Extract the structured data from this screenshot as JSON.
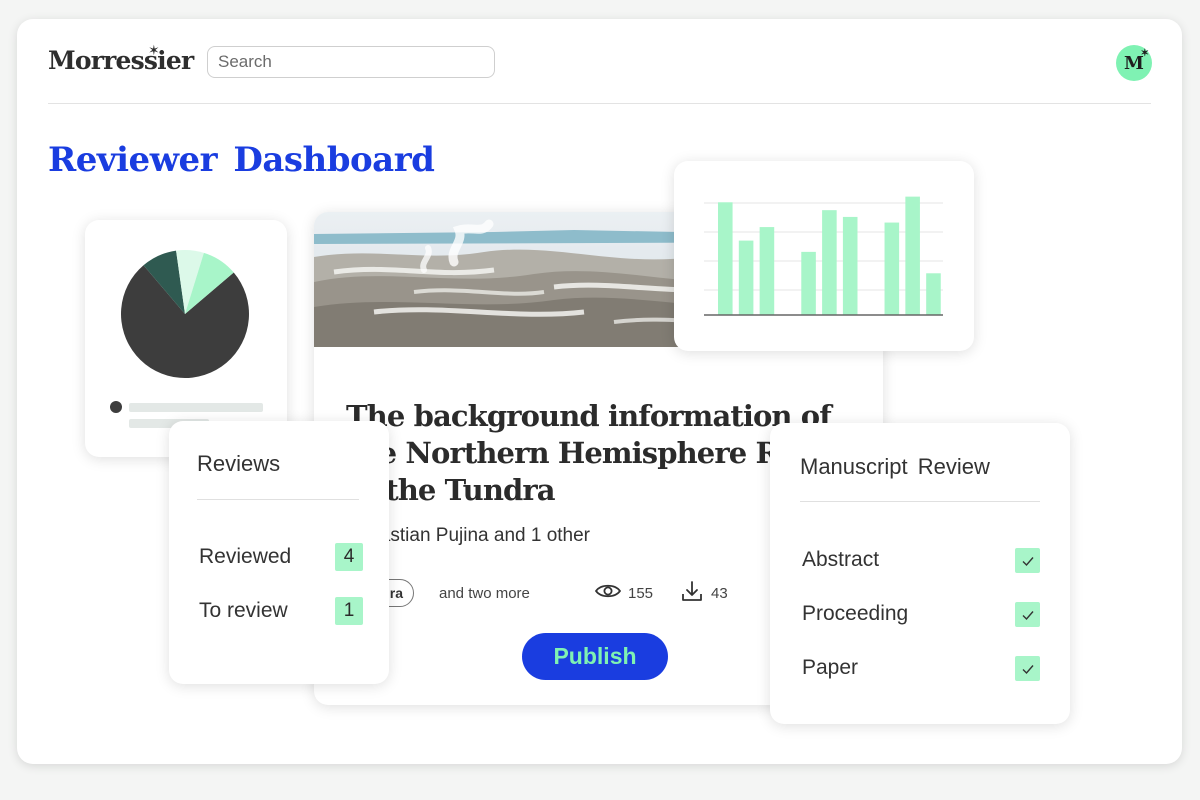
{
  "header": {
    "brand": "Morressier",
    "search_placeholder": "Search",
    "avatar_letter": "M"
  },
  "page_title": "Reviewer Dashboard",
  "article": {
    "title_lines": [
      "The background information of",
      "the Northern Hemisphere Region",
      "of the Tundra"
    ],
    "authors": "Sebastian Pujina and 1 other",
    "tag": "Tundra",
    "more_tags": "and two more",
    "views": "155",
    "downloads": "43",
    "publish_label": "Publish"
  },
  "reviews": {
    "title": "Reviews",
    "rows": [
      {
        "label": "Reviewed",
        "count": "4"
      },
      {
        "label": "To review",
        "count": "1"
      }
    ]
  },
  "manuscript": {
    "title": "Manuscript Review",
    "items": [
      {
        "label": "Abstract",
        "checked": true
      },
      {
        "label": "Proceeding",
        "checked": true
      },
      {
        "label": "Paper",
        "checked": true
      }
    ]
  },
  "colors": {
    "accent_blue": "#1a3de0",
    "mint": "#7ff2b3",
    "mint_light": "#a8f5c9",
    "pie_dark": "#3d3d3d",
    "pie_teal": "#2f5a51"
  },
  "chart_data": [
    {
      "type": "pie",
      "slices": [
        {
          "value": 75,
          "color": "#3d3d3d"
        },
        {
          "value": 9,
          "color": "#2f5a51"
        },
        {
          "value": 7,
          "color": "#dcf9e9"
        },
        {
          "value": 9,
          "color": "#a8f5c9"
        }
      ]
    },
    {
      "type": "bar",
      "values": [
        100,
        66,
        78,
        0,
        56,
        93,
        87,
        0,
        82,
        105,
        37
      ],
      "ylim": [
        0,
        110
      ],
      "color": "#a8f5c9",
      "grid": true
    }
  ]
}
